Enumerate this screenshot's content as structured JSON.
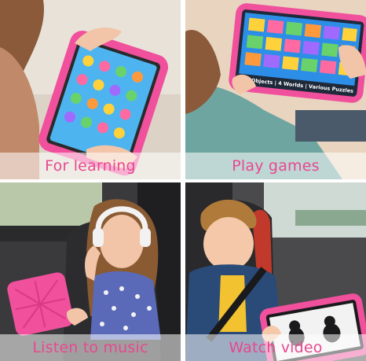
{
  "panels": [
    {
      "caption": "For learning"
    },
    {
      "caption": "Play games"
    },
    {
      "caption": "Listen to music"
    },
    {
      "caption": "Watch video"
    }
  ],
  "colors": {
    "caption": "#e8488f",
    "tablet_case": "#f0509c",
    "screen_blue": "#2d8ee8",
    "background_warm": "#e8d4bf"
  },
  "tablet_screen_text": "100 Objects | 4 Worlds | Various Puzzles"
}
